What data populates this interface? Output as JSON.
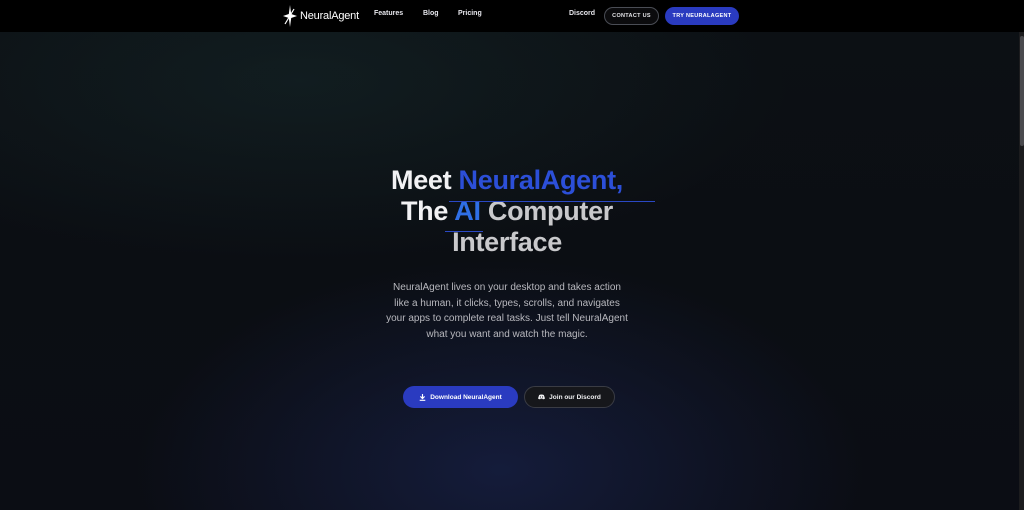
{
  "brand": {
    "name": "NeuralAgent"
  },
  "nav": {
    "links": [
      "Features",
      "Blog",
      "Pricing"
    ],
    "discord": "Discord",
    "contact": "CONTACT US",
    "try": "TRY NEURALAGENT"
  },
  "hero": {
    "title_part1": "Meet ",
    "title_part2": "NeuralAgent,",
    "title_part3": "The ",
    "title_part4": "AI",
    "title_part5": " Computer",
    "title_part6": "Interface",
    "description": "NeuralAgent lives on your desktop and takes action like a human, it clicks, types, scrolls, and navigates your apps to complete real tasks. Just tell NeuralAgent what you want and watch the magic.",
    "download_label": "Download NeuralAgent",
    "discord_label": "Join our Discord"
  },
  "icons": {
    "logo": "star-spark-icon",
    "download": "download-icon",
    "discord": "discord-icon"
  },
  "colors": {
    "accent": "#2a3bc0",
    "title_blue": "#2c4fd8",
    "background": "#0a0c10"
  }
}
